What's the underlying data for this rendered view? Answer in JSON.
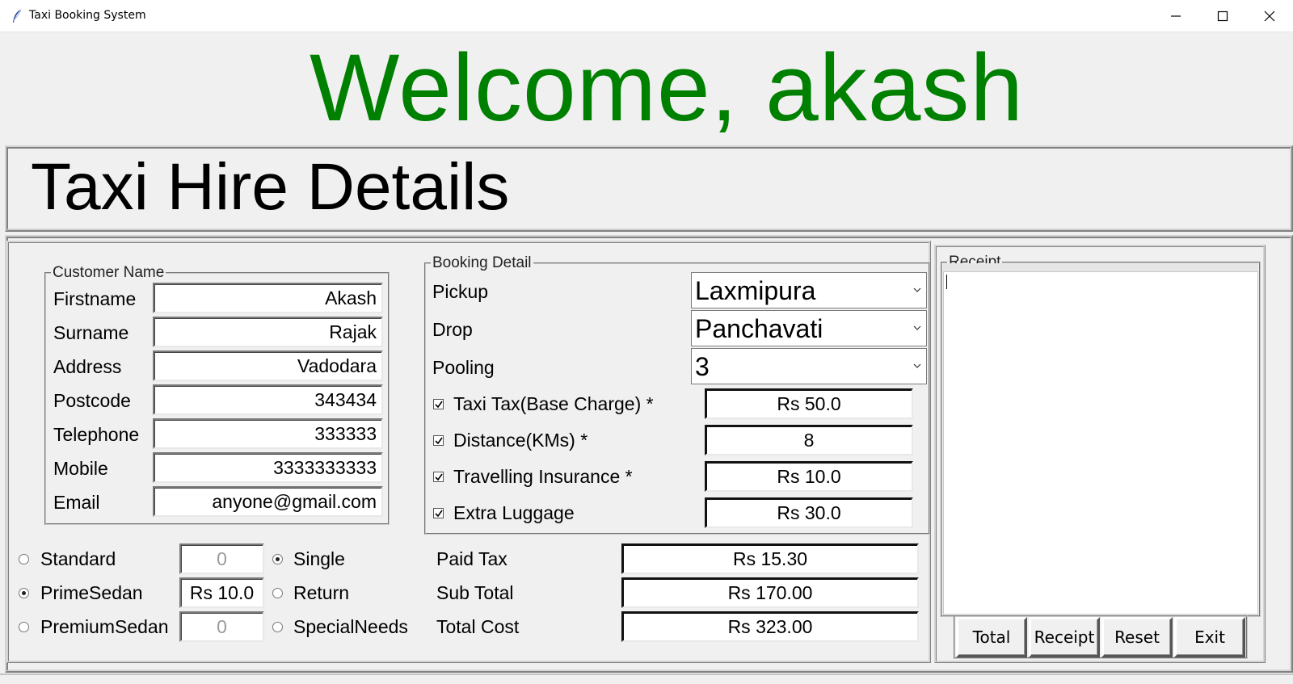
{
  "window": {
    "title": "Taxi Booking System",
    "controls": [
      "minimize",
      "maximize",
      "close"
    ]
  },
  "welcome_text": "Welcome, akash",
  "welcome_color": "#008000",
  "section_title": "Taxi Hire Details",
  "customer": {
    "legend": "Customer Name",
    "fields": [
      {
        "label": "Firstname",
        "value": "Akash"
      },
      {
        "label": "Surname",
        "value": "Rajak"
      },
      {
        "label": "Address",
        "value": "Vadodara"
      },
      {
        "label": "Postcode",
        "value": "343434"
      },
      {
        "label": "Telephone",
        "value": "333333"
      },
      {
        "label": "Mobile",
        "value": "3333333333"
      },
      {
        "label": "Email",
        "value": "anyone@gmail.com"
      }
    ]
  },
  "booking": {
    "legend": "Booking Detail",
    "pickup": {
      "label": "Pickup",
      "value": "Laxmipura"
    },
    "drop": {
      "label": "Drop",
      "value": "Panchavati"
    },
    "pooling": {
      "label": "Pooling",
      "value": "3"
    },
    "charges": [
      {
        "label": "Taxi Tax(Base Charge) *",
        "checked": true,
        "value": "Rs 50.0"
      },
      {
        "label": "Distance(KMs) *",
        "checked": true,
        "value": "8"
      },
      {
        "label": "Travelling Insurance *",
        "checked": true,
        "value": "Rs 10.0"
      },
      {
        "label": "Extra Luggage",
        "checked": true,
        "value": "Rs 30.0"
      }
    ]
  },
  "car_types": [
    {
      "label": "Standard",
      "selected": false,
      "value": "0"
    },
    {
      "label": "PrimeSedan",
      "selected": true,
      "value": "Rs 10.0"
    },
    {
      "label": "PremiumSedan",
      "selected": false,
      "value": "0"
    }
  ],
  "journey_types": [
    {
      "label": "Single",
      "selected": true
    },
    {
      "label": "Return",
      "selected": false
    },
    {
      "label": "SpecialNeeds",
      "selected": false
    }
  ],
  "totals": [
    {
      "label": "Paid Tax",
      "value": "Rs 15.30"
    },
    {
      "label": "Sub Total",
      "value": "Rs 170.00"
    },
    {
      "label": "Total Cost",
      "value": "Rs 323.00"
    }
  ],
  "receipt": {
    "legend": "Receipt",
    "text": ""
  },
  "buttons": {
    "total": "Total",
    "receipt": "Receipt",
    "reset": "Reset",
    "exit": "Exit"
  }
}
